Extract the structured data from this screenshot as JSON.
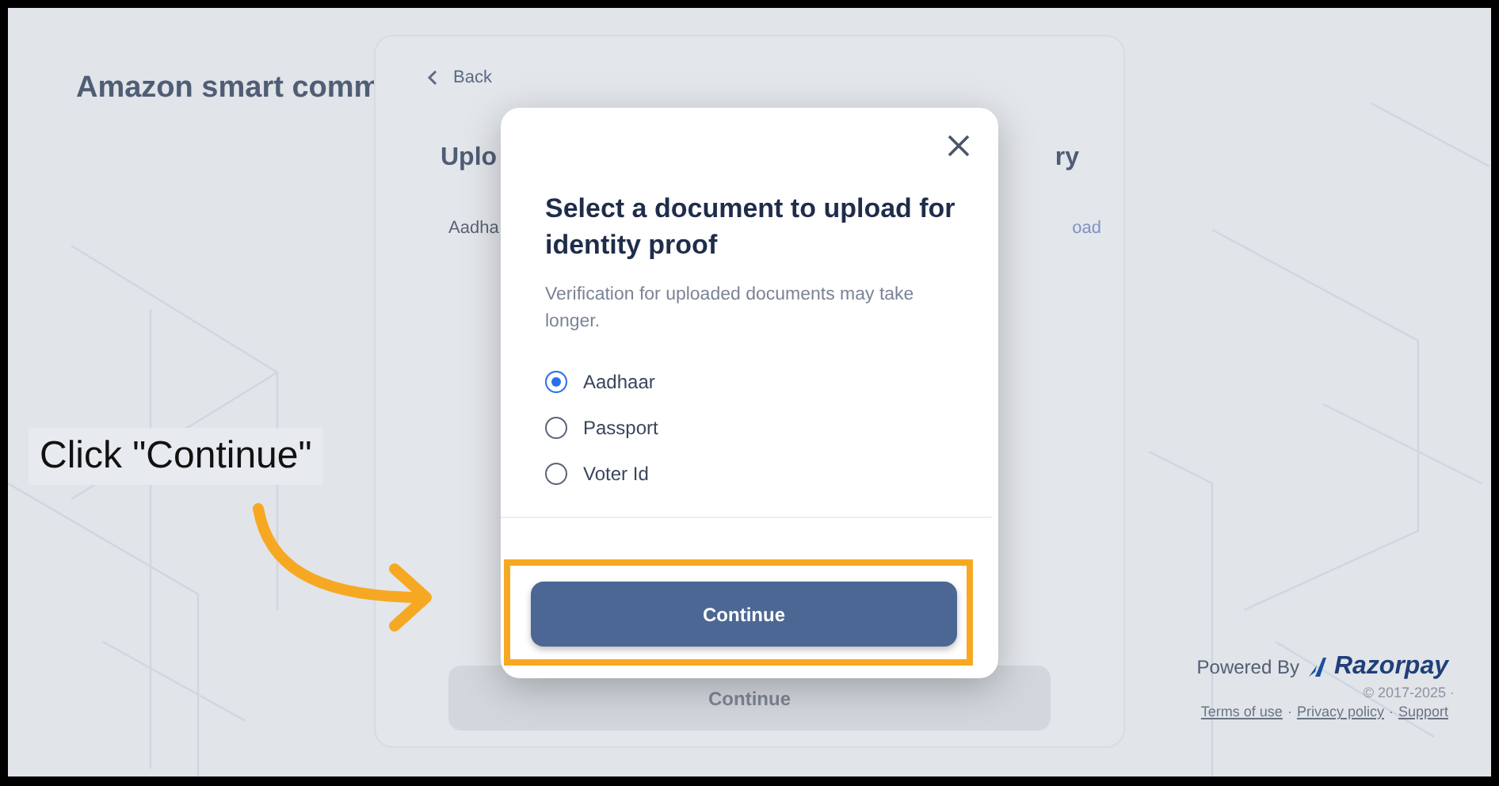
{
  "page": {
    "title": "Amazon smart comm"
  },
  "card": {
    "back_link": "Back",
    "heading_start": "Uplo",
    "heading_end": "ry",
    "document_label": "Aadha",
    "upload_link": "oad",
    "continue_button": {
      "label": "Continue",
      "disabled": true
    }
  },
  "dialog": {
    "title": "Select a document to upload for identity proof",
    "description": "Verification for uploaded documents may take longer.",
    "options": [
      {
        "label": "Aadhaar",
        "selected": true
      },
      {
        "label": "Passport",
        "selected": false
      },
      {
        "label": "Voter Id",
        "selected": false
      }
    ],
    "continue_button": "Continue"
  },
  "footer": {
    "powered_by": "Powered By",
    "brand": "Razorpay",
    "copyright": "© 2017-2025 ·",
    "links": [
      "Terms of use",
      "Privacy policy",
      "Support"
    ],
    "link_separator": "·"
  },
  "annotation": {
    "label": "Click \"Continue\""
  }
}
